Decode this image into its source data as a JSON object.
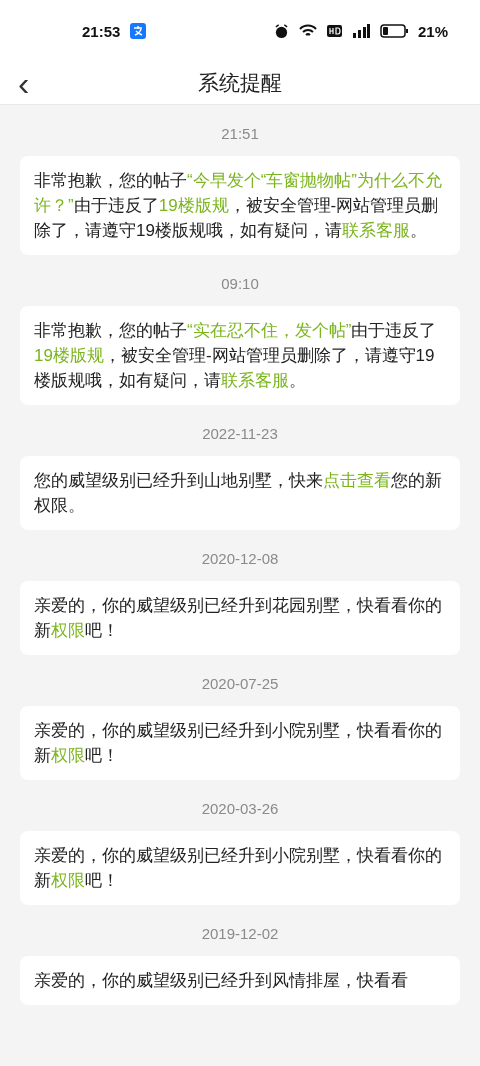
{
  "status_bar": {
    "time": "21:53",
    "battery": "21%"
  },
  "header": {
    "back": "‹",
    "title": "系统提醒"
  },
  "messages": [
    {
      "time": "21:51",
      "segments": [
        {
          "kind": "text",
          "text": "非常抱歉，您的帖子"
        },
        {
          "kind": "quote",
          "text": "“今早发个“车窗抛物帖”为什么不允许？”"
        },
        {
          "kind": "text",
          "text": "由于违反了"
        },
        {
          "kind": "link",
          "text": "19楼版规"
        },
        {
          "kind": "text",
          "text": "，被安全管理-网站管理员删除了，请遵守19楼版规哦，如有疑问，请"
        },
        {
          "kind": "link",
          "text": "联系客服"
        },
        {
          "kind": "text",
          "text": "。"
        }
      ]
    },
    {
      "time": "09:10",
      "segments": [
        {
          "kind": "text",
          "text": "非常抱歉，您的帖子"
        },
        {
          "kind": "quote",
          "text": "“实在忍不住，发个帖”"
        },
        {
          "kind": "text",
          "text": "由于违反了"
        },
        {
          "kind": "link",
          "text": "19楼版规"
        },
        {
          "kind": "text",
          "text": "，被安全管理-网站管理员删除了，请遵守19楼版规哦，如有疑问，请"
        },
        {
          "kind": "link",
          "text": "联系客服"
        },
        {
          "kind": "text",
          "text": "。"
        }
      ]
    },
    {
      "time": "2022-11-23",
      "segments": [
        {
          "kind": "text",
          "text": "您的威望级别已经升到山地别墅，快来"
        },
        {
          "kind": "link",
          "text": "点击查看"
        },
        {
          "kind": "text",
          "text": "您的新权限。"
        }
      ]
    },
    {
      "time": "2020-12-08",
      "segments": [
        {
          "kind": "text",
          "text": "亲爱的，你的威望级别已经升到花园别墅，快看看你的新"
        },
        {
          "kind": "link",
          "text": "权限"
        },
        {
          "kind": "text",
          "text": "吧！"
        }
      ]
    },
    {
      "time": "2020-07-25",
      "segments": [
        {
          "kind": "text",
          "text": "亲爱的，你的威望级别已经升到小院别墅，快看看你的新"
        },
        {
          "kind": "link",
          "text": "权限"
        },
        {
          "kind": "text",
          "text": "吧！"
        }
      ]
    },
    {
      "time": "2020-03-26",
      "segments": [
        {
          "kind": "text",
          "text": "亲爱的，你的威望级别已经升到小院别墅，快看看你的新"
        },
        {
          "kind": "link",
          "text": "权限"
        },
        {
          "kind": "text",
          "text": "吧！"
        }
      ]
    },
    {
      "time": "2019-12-02",
      "segments": [
        {
          "kind": "text",
          "text": "亲爱的，你的威望级别已经升到风情排屋，快看看"
        }
      ]
    }
  ]
}
